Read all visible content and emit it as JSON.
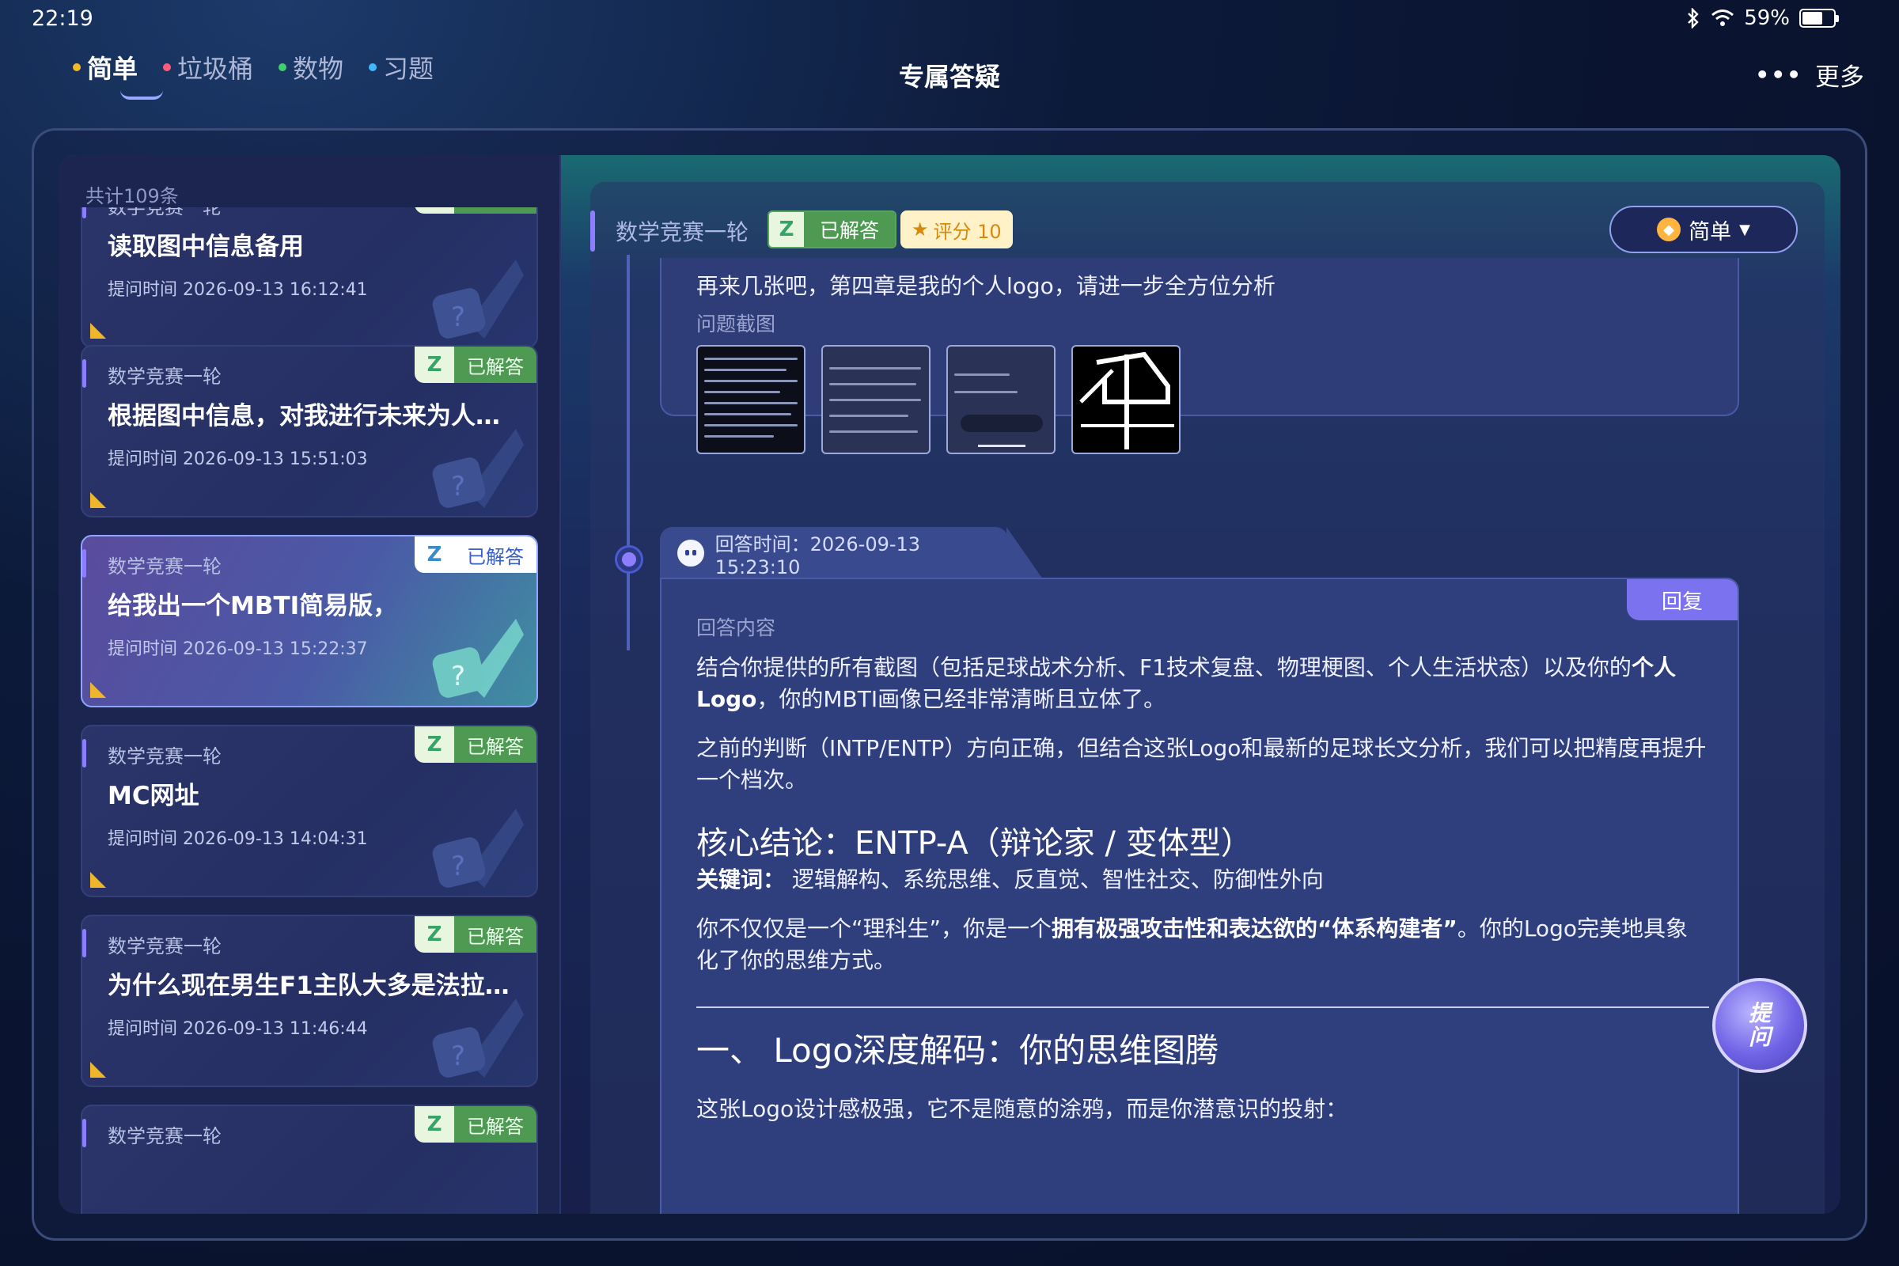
{
  "status": {
    "time": "22:19",
    "bluetooth_icon": "bluetooth-icon",
    "wifi_icon": "wifi-icon",
    "battery": "59%"
  },
  "nav": {
    "tabs": [
      {
        "label": "简单",
        "color": "#f2b928"
      },
      {
        "label": "垃圾桶",
        "color": "#ff5b7a"
      },
      {
        "label": "数物",
        "color": "#3fd06a"
      },
      {
        "label": "习题",
        "color": "#3fb8ff"
      }
    ],
    "title": "专属答疑",
    "more_label": "更多"
  },
  "list": {
    "count": "共计109条",
    "items": [
      {
        "category": "数学竞赛一轮",
        "status": "已解答",
        "title": "读取图中信息备用",
        "time": "提问时间 2026-09-13 16:12:41"
      },
      {
        "category": "数学竞赛一轮",
        "status": "已解答",
        "title": "根据图中信息，对我进行未来为人规划",
        "time": "提问时间 2026-09-13 15:51:03"
      },
      {
        "category": "数学竞赛一轮",
        "status": "已解答",
        "title": "给我出一个MBTI简易版，",
        "time": "提问时间 2026-09-13 15:22:37"
      },
      {
        "category": "数学竞赛一轮",
        "status": "已解答",
        "title": "MC网址",
        "time": "提问时间 2026-09-13 14:04:31"
      },
      {
        "category": "数学竞赛一轮",
        "status": "已解答",
        "title": "为什么现在男生F1主队大多是法拉利…",
        "time": "提问时间 2026-09-13 11:46:44"
      },
      {
        "category": "数学竞赛一轮",
        "status": "已解答",
        "title": "",
        "time": ""
      }
    ]
  },
  "detail": {
    "subject": "数学竞赛一轮",
    "status": "已解答",
    "rating": "评分 10",
    "level": "简单",
    "question_text": "再来几张吧，第四章是我的个人logo，请进一步全方位分析",
    "screenshots_label": "问题截图",
    "answer_time": "回答时间：2026-09-13 15:23:10",
    "reply_label": "回复",
    "answer_label": "回答内容",
    "para1_a": "结合你提供的所有截图（包括足球战术分析、F1技术复盘、物理梗图、个人生活状态）以及你的",
    "para1_b": "个人Logo",
    "para1_c": "，你的MBTI画像已经非常清晰且立体了。",
    "para2": "之前的判断（INTP/ENTP）方向正确，但结合这张Logo和最新的足球长文分析，我们可以把精度再提升一个档次。",
    "heading": "核心结论：ENTP-A（辩论家 / 变体型）",
    "kw_label": "关键词：",
    "keywords": "逻辑解构、系统思维、反直觉、智性社交、防御性外向",
    "para3_a": "你不仅仅是一个“理科生”，你是一个",
    "para3_b": "拥有极强攻击性和表达欲的“体系构建者”",
    "para3_c": "。你的Logo完美地具象化了你的思维方式。",
    "section_title": "一、 Logo深度解码：你的思维图腾",
    "para4": "这张Logo设计感极强，它不是随意的涂鸦，而是你潜意识的投射：",
    "ask_label": "提问"
  }
}
